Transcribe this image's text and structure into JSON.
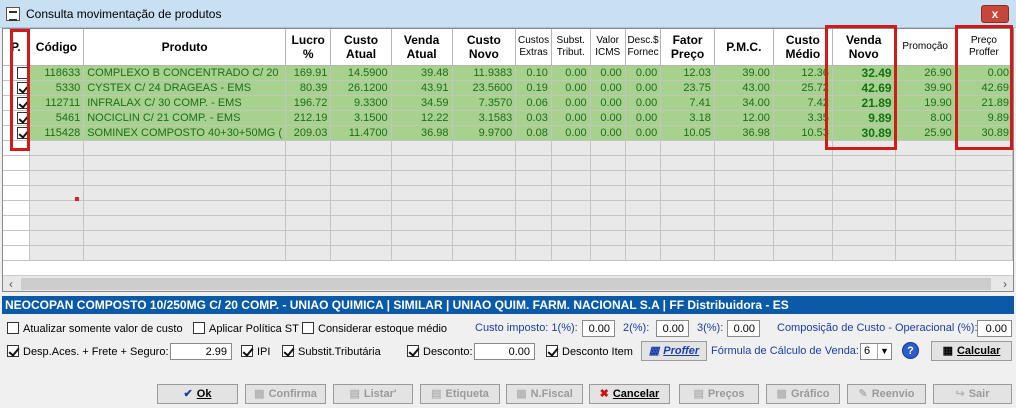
{
  "window": {
    "title": "Consulta movimentação de produtos",
    "close_label": "x"
  },
  "grid": {
    "columns": [
      "P.",
      "Código",
      "Produto",
      "Lucro %",
      "Custo Atual",
      "Venda Atual",
      "Custo Novo",
      "Custos Extras",
      "Subst. Tribut.",
      "Valor ICMS",
      "Desc.$ Fornec",
      "Fator Preço",
      "P.M.C.",
      "Custo Médio",
      "Venda Novo",
      "Promoção",
      "Preço Proffer"
    ],
    "rows": [
      {
        "checked": false,
        "codigo": "118633",
        "produto": "COMPLEXO B CONCENTRADO C/ 20",
        "lucro": "169.91",
        "custo_atual": "14.5900",
        "venda_atual": "39.48",
        "custo_novo": "11.9383",
        "custos_extras": "0.10",
        "subst": "0.00",
        "icms": "0.00",
        "desc": "0.00",
        "fator": "12.03",
        "pmc": "39.00",
        "custo_medio": "12.36",
        "venda_novo": "32.49",
        "promocao": "26.90",
        "proffer": "0.00"
      },
      {
        "checked": true,
        "codigo": "5330",
        "produto": "CYSTEX C/ 24 DRAGEAS - EMS",
        "lucro": "80.39",
        "custo_atual": "26.1200",
        "venda_atual": "43.91",
        "custo_novo": "23.5600",
        "custos_extras": "0.19",
        "subst": "0.00",
        "icms": "0.00",
        "desc": "0.00",
        "fator": "23.75",
        "pmc": "43.00",
        "custo_medio": "25.72",
        "venda_novo": "42.69",
        "promocao": "39.90",
        "proffer": "42.69"
      },
      {
        "checked": true,
        "codigo": "112711",
        "produto": "INFRALAX C/ 30 COMP. - EMS",
        "lucro": "196.72",
        "custo_atual": "9.3300",
        "venda_atual": "34.59",
        "custo_novo": "7.3570",
        "custos_extras": "0.06",
        "subst": "0.00",
        "icms": "0.00",
        "desc": "0.00",
        "fator": "7.41",
        "pmc": "34.00",
        "custo_medio": "7.42",
        "venda_novo": "21.89",
        "promocao": "19.90",
        "proffer": "21.89"
      },
      {
        "checked": true,
        "codigo": "5461",
        "produto": "NOCICLIN C/ 21 COMP. - EMS",
        "lucro": "212.19",
        "custo_atual": "3.1500",
        "venda_atual": "12.22",
        "custo_novo": "3.1583",
        "custos_extras": "0.03",
        "subst": "0.00",
        "icms": "0.00",
        "desc": "0.00",
        "fator": "3.18",
        "pmc": "12.00",
        "custo_medio": "3.35",
        "venda_novo": "9.89",
        "promocao": "8.00",
        "proffer": "9.89"
      },
      {
        "checked": true,
        "codigo": "115428",
        "produto": "SOMINEX COMPOSTO 40+30+50MG (",
        "lucro": "209.03",
        "custo_atual": "11.4700",
        "venda_atual": "36.98",
        "custo_novo": "9.9700",
        "custos_extras": "0.08",
        "subst": "0.00",
        "icms": "0.00",
        "desc": "0.00",
        "fator": "10.05",
        "pmc": "36.98",
        "custo_medio": "10.53",
        "venda_novo": "30.89",
        "promocao": "25.90",
        "proffer": "30.89"
      }
    ]
  },
  "product_bar": "NEOCOPAN COMPOSTO 10/250MG C/ 20 COMP. - UNIAO QUIMICA | SIMILAR | UNIAO QUIM. FARM. NACIONAL S.A | FF Distribuidora - ES",
  "options": {
    "atualizar": "Atualizar somente valor de custo",
    "politica": "Aplicar Política ST",
    "estoque": "Considerar estoque médio",
    "custo_imposto_label": "Custo imposto: 1(%):",
    "imp1": "0.00",
    "imp2_label": "2(%):",
    "imp2": "0.00",
    "imp3_label": "3(%):",
    "imp3": "0.00",
    "composicao_label": "Composição de Custo - Operacional (%):",
    "composicao": "0.00",
    "desp_label": "Desp.Aces. + Frete + Seguro:",
    "desp": "2.99",
    "ipi": "IPI",
    "subst": "Substit.Tributária",
    "desconto_label": "Desconto:",
    "desconto": "0.00",
    "desconto_item": "Desconto Item",
    "proffer_btn": "Proffer",
    "formula_label": "Fórmula de Cálculo de Venda:",
    "formula": "6",
    "help": "?",
    "calcular": "Calcular"
  },
  "buttons": {
    "ok": "Ok",
    "confirma": "Confirma",
    "listar": "Listar'",
    "etiqueta": "Etiqueta",
    "nfiscal": "N.Fiscal",
    "cancelar": "Cancelar",
    "precos": "Preços",
    "grafico": "Gráfico",
    "reenvio": "Reenvio",
    "sair": "Sair"
  }
}
